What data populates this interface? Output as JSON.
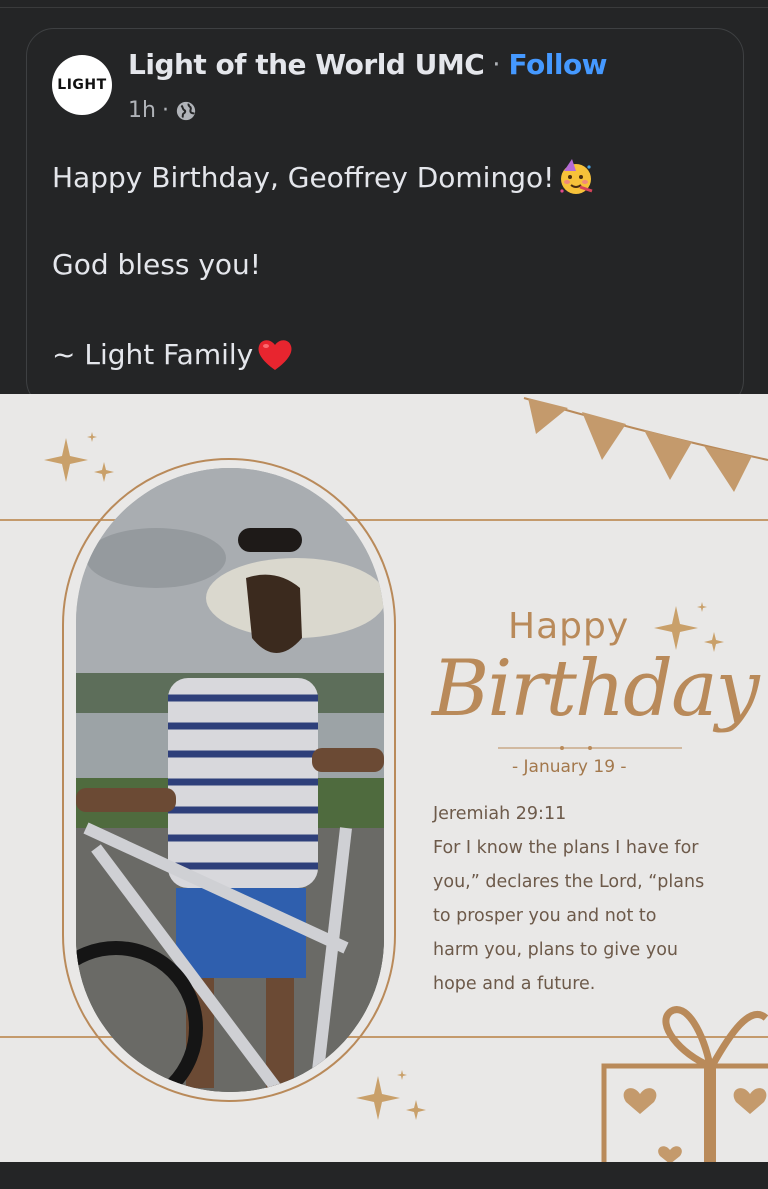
{
  "post": {
    "author": "Light of the World UMC",
    "separator": "·",
    "follow_label": "Follow",
    "avatar_text": "LIGHT",
    "time": "1h",
    "meta_dot": "·",
    "audience_icon": "globe-icon",
    "lines": [
      "Happy Birthday, Geoffrey Domingo!",
      "God bless you!",
      "~ Light Family"
    ],
    "emojis": [
      "party-face-emoji",
      "red-heart-emoji"
    ]
  },
  "card": {
    "happy": "Happy",
    "birthday": "Birthday",
    "date": "- January 19 -",
    "verse_ref": "Jeremiah 29:11",
    "verse_lines": [
      "For I know the plans I have for",
      "you,” declares the Lord, “plans",
      "to prosper you and not to",
      "harm you, plans to give you",
      "hope and a future."
    ],
    "accent_color": "#b98a5a",
    "background_color": "#e9e8e7"
  }
}
